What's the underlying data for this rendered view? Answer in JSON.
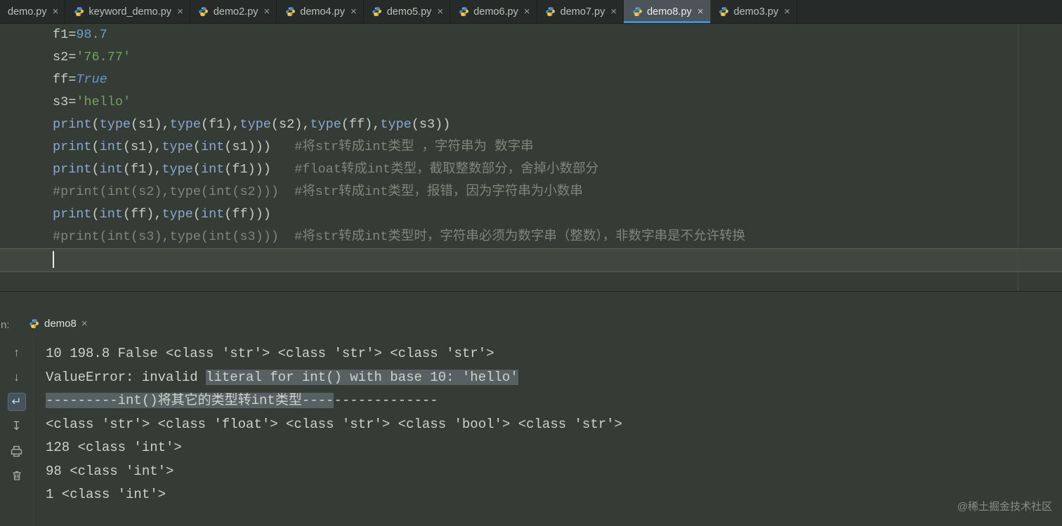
{
  "window": {
    "watermark": "@稀土掘金技术社区"
  },
  "colors": {
    "editor_bg": "#353b35",
    "tabbar_bg": "#262b29",
    "active_tab_bg": "#4c545a",
    "accent_blue": "#3d8fd1",
    "caret_line_bg": "#40473f",
    "selection": "#576063",
    "code_plain": "#c6cfc9",
    "code_builtin": "#8aa7d3",
    "code_number": "#6d9dc5",
    "code_string": "#74a25e",
    "code_keyword": "#6796c9",
    "code_comment": "#7d867d",
    "console_text": "#ccd3cb"
  },
  "editor_tabs": [
    {
      "label": "demo.py",
      "close": "×",
      "active": false,
      "icon": false
    },
    {
      "label": "keyword_demo.py",
      "close": "×",
      "active": false,
      "icon": true
    },
    {
      "label": "demo2.py",
      "close": "×",
      "active": false,
      "icon": true
    },
    {
      "label": "demo4.py",
      "close": "×",
      "active": false,
      "icon": true
    },
    {
      "label": "demo5.py",
      "close": "×",
      "active": false,
      "icon": true
    },
    {
      "label": "demo6.py",
      "close": "×",
      "active": false,
      "icon": true
    },
    {
      "label": "demo7.py",
      "close": "×",
      "active": false,
      "icon": true
    },
    {
      "label": "demo8.py",
      "close": "×",
      "active": true,
      "icon": true
    },
    {
      "label": "demo3.py",
      "close": "×",
      "active": false,
      "icon": true
    }
  ],
  "editor": {
    "lines": [
      {
        "tokens": [
          {
            "t": "f1",
            "c": "plain"
          },
          {
            "t": "=",
            "c": "plain"
          },
          {
            "t": "98.7",
            "c": "number"
          }
        ]
      },
      {
        "tokens": [
          {
            "t": "s2",
            "c": "plain"
          },
          {
            "t": "=",
            "c": "plain"
          },
          {
            "t": "'76.77'",
            "c": "string"
          }
        ]
      },
      {
        "tokens": [
          {
            "t": "ff",
            "c": "plain"
          },
          {
            "t": "=",
            "c": "plain"
          },
          {
            "t": "True",
            "c": "keyword"
          }
        ]
      },
      {
        "tokens": [
          {
            "t": "s3",
            "c": "plain"
          },
          {
            "t": "=",
            "c": "plain"
          },
          {
            "t": "'hello'",
            "c": "string"
          }
        ]
      },
      {
        "tokens": [
          {
            "t": "print",
            "c": "builtin"
          },
          {
            "t": "(",
            "c": "plain"
          },
          {
            "t": "type",
            "c": "builtin"
          },
          {
            "t": "(s1),",
            "c": "plain"
          },
          {
            "t": "type",
            "c": "builtin"
          },
          {
            "t": "(f1),",
            "c": "plain"
          },
          {
            "t": "type",
            "c": "builtin"
          },
          {
            "t": "(s2),",
            "c": "plain"
          },
          {
            "t": "type",
            "c": "builtin"
          },
          {
            "t": "(ff),",
            "c": "plain"
          },
          {
            "t": "type",
            "c": "builtin"
          },
          {
            "t": "(s3))",
            "c": "plain"
          }
        ]
      },
      {
        "tokens": [
          {
            "t": "print",
            "c": "builtin"
          },
          {
            "t": "(",
            "c": "plain"
          },
          {
            "t": "int",
            "c": "builtin"
          },
          {
            "t": "(s1),",
            "c": "plain"
          },
          {
            "t": "type",
            "c": "builtin"
          },
          {
            "t": "(",
            "c": "plain"
          },
          {
            "t": "int",
            "c": "builtin"
          },
          {
            "t": "(s1)))",
            "c": "plain"
          },
          {
            "t": "   #将str转成int类型 ，字符串为 数字串",
            "c": "comment"
          }
        ]
      },
      {
        "tokens": [
          {
            "t": "print",
            "c": "builtin"
          },
          {
            "t": "(",
            "c": "plain"
          },
          {
            "t": "int",
            "c": "builtin"
          },
          {
            "t": "(f1),",
            "c": "plain"
          },
          {
            "t": "type",
            "c": "builtin"
          },
          {
            "t": "(",
            "c": "plain"
          },
          {
            "t": "int",
            "c": "builtin"
          },
          {
            "t": "(f1)))",
            "c": "plain"
          },
          {
            "t": "   #float转成int类型，截取整数部分，舍掉小数部分",
            "c": "comment"
          }
        ]
      },
      {
        "tokens": [
          {
            "t": "#print(int(s2),type(int(s2)))  #将str转成int类型，报错，因为字符串为小数串",
            "c": "comment"
          }
        ]
      },
      {
        "tokens": [
          {
            "t": "print",
            "c": "builtin"
          },
          {
            "t": "(",
            "c": "plain"
          },
          {
            "t": "int",
            "c": "builtin"
          },
          {
            "t": "(ff),",
            "c": "plain"
          },
          {
            "t": "type",
            "c": "builtin"
          },
          {
            "t": "(",
            "c": "plain"
          },
          {
            "t": "int",
            "c": "builtin"
          },
          {
            "t": "(ff)))",
            "c": "plain"
          }
        ]
      },
      {
        "tokens": [
          {
            "t": "#print(int(s3),type(int(s3)))  #将str转成int类型时，字符串必须为数字串（整数），非数字串是不允许转换",
            "c": "comment"
          }
        ]
      },
      {
        "cursor": true,
        "tokens": []
      }
    ]
  },
  "run_panel": {
    "window_label": "n:",
    "tab": {
      "label": "demo8",
      "close": "×"
    },
    "toolbar": {
      "up": "↑",
      "down": "↓",
      "softwrap": "↵",
      "scrollend": "↧"
    },
    "console_lines": [
      {
        "segments": [
          {
            "t": "10 198.8 False <class 'str'> <class 'str'> <class 'str'>",
            "sel": false
          }
        ]
      },
      {
        "segments": [
          {
            "t": "ValueError: invalid ",
            "sel": false
          },
          {
            "t": "literal for int() with base 10: 'hello'",
            "sel": true
          }
        ]
      },
      {
        "segments": [
          {
            "t": "---------int()将其它的类型转int类型----",
            "sel": true
          },
          {
            "t": "-------------",
            "sel": false
          }
        ]
      },
      {
        "segments": [
          {
            "t": "<class 'str'> <class 'float'> <class 'str'> <class 'bool'> <class 'str'>",
            "sel": false
          }
        ]
      },
      {
        "segments": [
          {
            "t": "128 <class 'int'>",
            "sel": false
          }
        ]
      },
      {
        "segments": [
          {
            "t": "98 <class 'int'>",
            "sel": false
          }
        ]
      },
      {
        "segments": [
          {
            "t": "1 <class 'int'>",
            "sel": false
          }
        ]
      }
    ]
  }
}
